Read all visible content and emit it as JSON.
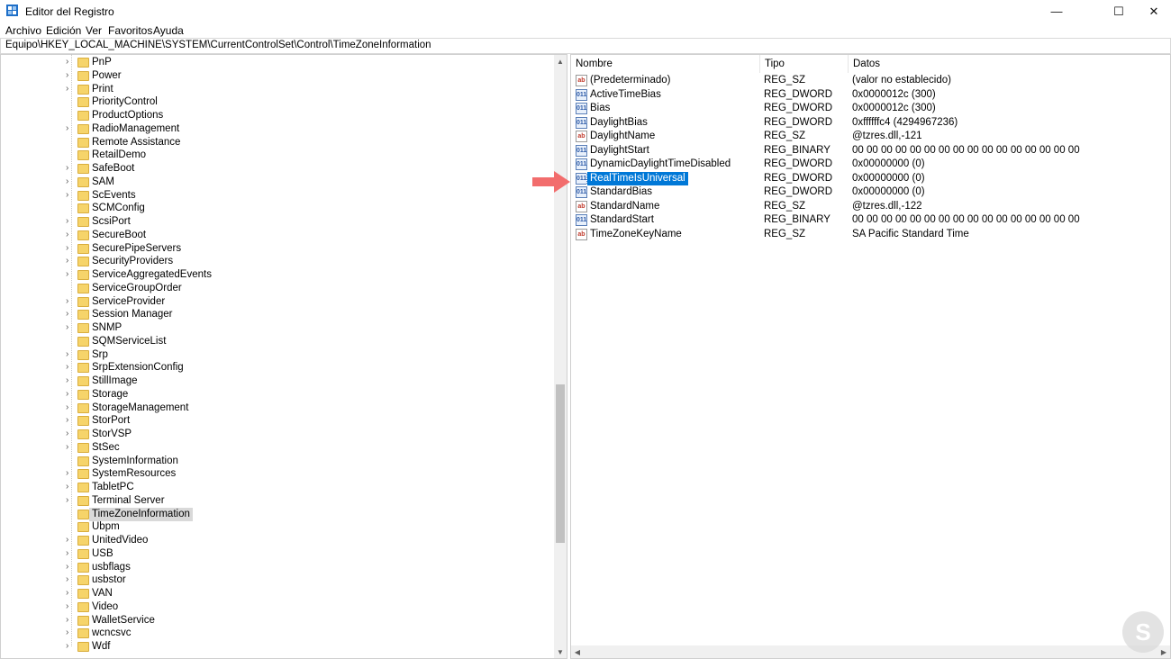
{
  "window": {
    "title": "Editor del Registro",
    "minimize_glyph": "—",
    "maximize_glyph": "☐",
    "close_glyph": "✕"
  },
  "menu": [
    "Archivo",
    "Edición",
    "Ver",
    "Favoritos",
    "Ayuda"
  ],
  "address": "Equipo\\HKEY_LOCAL_MACHINE\\SYSTEM\\CurrentControlSet\\Control\\TimeZoneInformation",
  "tree": {
    "items": [
      {
        "label": "PnP",
        "expandable": true
      },
      {
        "label": "Power",
        "expandable": true
      },
      {
        "label": "Print",
        "expandable": true
      },
      {
        "label": "PriorityControl",
        "expandable": false
      },
      {
        "label": "ProductOptions",
        "expandable": false
      },
      {
        "label": "RadioManagement",
        "expandable": true
      },
      {
        "label": "Remote Assistance",
        "expandable": false
      },
      {
        "label": "RetailDemo",
        "expandable": false
      },
      {
        "label": "SafeBoot",
        "expandable": true
      },
      {
        "label": "SAM",
        "expandable": true
      },
      {
        "label": "ScEvents",
        "expandable": true
      },
      {
        "label": "SCMConfig",
        "expandable": false
      },
      {
        "label": "ScsiPort",
        "expandable": true
      },
      {
        "label": "SecureBoot",
        "expandable": true
      },
      {
        "label": "SecurePipeServers",
        "expandable": true
      },
      {
        "label": "SecurityProviders",
        "expandable": true
      },
      {
        "label": "ServiceAggregatedEvents",
        "expandable": true
      },
      {
        "label": "ServiceGroupOrder",
        "expandable": false
      },
      {
        "label": "ServiceProvider",
        "expandable": true
      },
      {
        "label": "Session Manager",
        "expandable": true
      },
      {
        "label": "SNMP",
        "expandable": true
      },
      {
        "label": "SQMServiceList",
        "expandable": false
      },
      {
        "label": "Srp",
        "expandable": true
      },
      {
        "label": "SrpExtensionConfig",
        "expandable": true
      },
      {
        "label": "StillImage",
        "expandable": true
      },
      {
        "label": "Storage",
        "expandable": true
      },
      {
        "label": "StorageManagement",
        "expandable": true
      },
      {
        "label": "StorPort",
        "expandable": true
      },
      {
        "label": "StorVSP",
        "expandable": true
      },
      {
        "label": "StSec",
        "expandable": true
      },
      {
        "label": "SystemInformation",
        "expandable": false
      },
      {
        "label": "SystemResources",
        "expandable": true
      },
      {
        "label": "TabletPC",
        "expandable": true
      },
      {
        "label": "Terminal Server",
        "expandable": true
      },
      {
        "label": "TimeZoneInformation",
        "expandable": false,
        "selected": true
      },
      {
        "label": "Ubpm",
        "expandable": false
      },
      {
        "label": "UnitedVideo",
        "expandable": true
      },
      {
        "label": "USB",
        "expandable": true
      },
      {
        "label": "usbflags",
        "expandable": true
      },
      {
        "label": "usbstor",
        "expandable": true
      },
      {
        "label": "VAN",
        "expandable": true
      },
      {
        "label": "Video",
        "expandable": true
      },
      {
        "label": "WalletService",
        "expandable": true
      },
      {
        "label": "wcncsvc",
        "expandable": true
      },
      {
        "label": "Wdf",
        "expandable": true
      }
    ]
  },
  "values": {
    "columns": [
      "Nombre",
      "Tipo",
      "Datos"
    ],
    "rows": [
      {
        "name": "(Predeterminado)",
        "type": "REG_SZ",
        "data": "(valor no establecido)",
        "icon": "ab"
      },
      {
        "name": "ActiveTimeBias",
        "type": "REG_DWORD",
        "data": "0x0000012c (300)",
        "icon": "011"
      },
      {
        "name": "Bias",
        "type": "REG_DWORD",
        "data": "0x0000012c (300)",
        "icon": "011"
      },
      {
        "name": "DaylightBias",
        "type": "REG_DWORD",
        "data": "0xffffffc4 (4294967236)",
        "icon": "011"
      },
      {
        "name": "DaylightName",
        "type": "REG_SZ",
        "data": "@tzres.dll,-121",
        "icon": "ab"
      },
      {
        "name": "DaylightStart",
        "type": "REG_BINARY",
        "data": "00 00 00 00 00 00 00 00 00 00 00 00 00 00 00 00",
        "icon": "011"
      },
      {
        "name": "DynamicDaylightTimeDisabled",
        "type": "REG_DWORD",
        "data": "0x00000000 (0)",
        "icon": "011"
      },
      {
        "name": "RealTimeIsUniversal",
        "type": "REG_DWORD",
        "data": "0x00000000 (0)",
        "icon": "011",
        "selected": true
      },
      {
        "name": "StandardBias",
        "type": "REG_DWORD",
        "data": "0x00000000 (0)",
        "icon": "011"
      },
      {
        "name": "StandardName",
        "type": "REG_SZ",
        "data": "@tzres.dll,-122",
        "icon": "ab"
      },
      {
        "name": "StandardStart",
        "type": "REG_BINARY",
        "data": "00 00 00 00 00 00 00 00 00 00 00 00 00 00 00 00",
        "icon": "011"
      },
      {
        "name": "TimeZoneKeyName",
        "type": "REG_SZ",
        "data": "SA Pacific Standard Time",
        "icon": "ab"
      }
    ]
  },
  "colors": {
    "selection": "#0078d7",
    "annotation_arrow": "#f26d6d",
    "folder": "#f6d46a"
  }
}
